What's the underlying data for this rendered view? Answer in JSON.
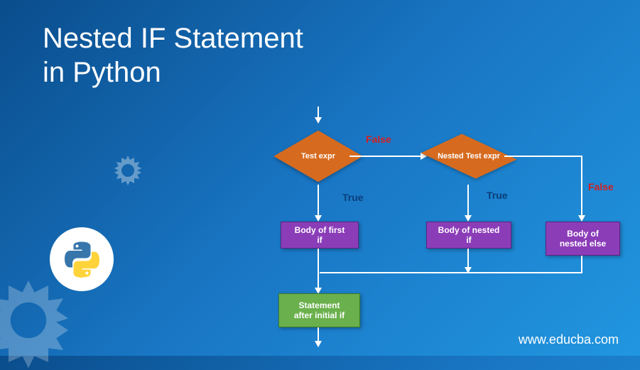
{
  "title_line1": "Nested IF Statement",
  "title_line2": "in Python",
  "url": "www.educba.com",
  "diagram": {
    "test_expr": "Test expr",
    "nested_test_expr": "Nested Test  expr",
    "body_first_if": "Body of first if",
    "body_nested_if": "Body of nested if",
    "body_nested_else": "Body of nested else",
    "statement_after": "Statement after initial if",
    "label_false1": "False",
    "label_false2": "False",
    "label_true1": "True",
    "label_true2": "True"
  }
}
